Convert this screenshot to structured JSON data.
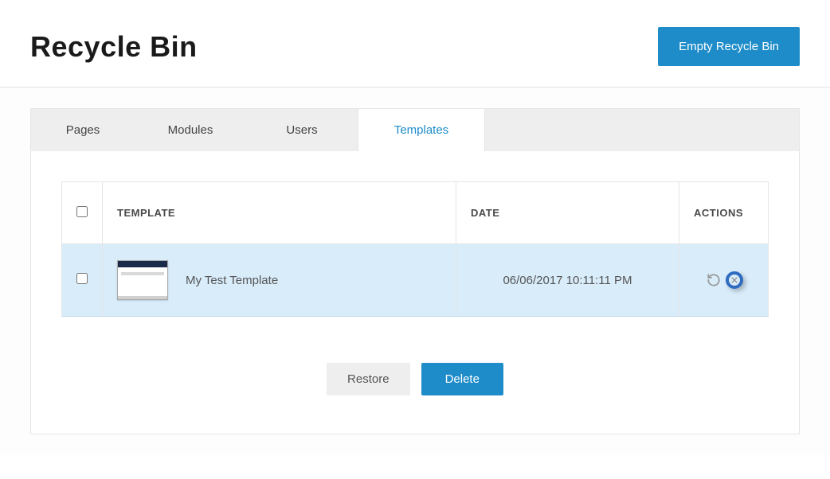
{
  "header": {
    "title": "Recycle Bin",
    "empty_button": "Empty Recycle Bin"
  },
  "tabs": {
    "pages": "Pages",
    "modules": "Modules",
    "users": "Users",
    "templates": "Templates",
    "active": "templates"
  },
  "table": {
    "columns": {
      "template": "TEMPLATE",
      "date": "DATE",
      "actions": "ACTIONS"
    },
    "rows": [
      {
        "name": "My Test Template",
        "date": "06/06/2017 10:11:11 PM",
        "selected": true
      }
    ]
  },
  "footer": {
    "restore": "Restore",
    "delete": "Delete"
  }
}
